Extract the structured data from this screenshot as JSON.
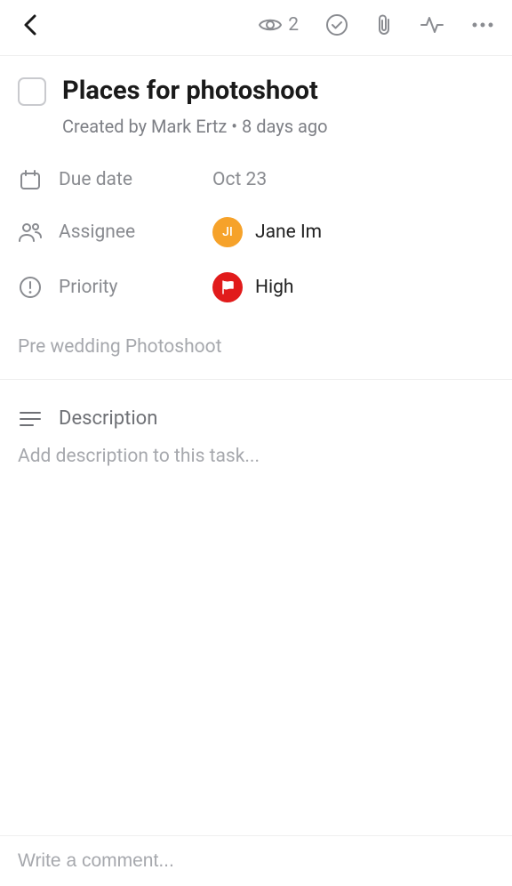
{
  "header": {
    "watcher_count": "2"
  },
  "task": {
    "title": "Places for photoshoot",
    "created_by": "Created by Mark Ertz",
    "created_ago": "8 days ago",
    "separator": " • "
  },
  "fields": {
    "due_date_label": "Due date",
    "due_date_value": "Oct 23",
    "assignee_label": "Assignee",
    "assignee_initials": "JI",
    "assignee_name": "Jane Im",
    "priority_label": "Priority",
    "priority_value": "High"
  },
  "project_line": "Pre wedding Photoshoot",
  "description": {
    "label": "Description",
    "placeholder": "Add description to this task..."
  },
  "comment": {
    "placeholder": "Write a comment..."
  }
}
